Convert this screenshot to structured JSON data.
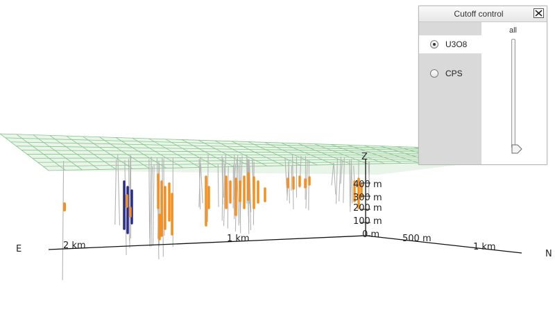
{
  "scene": {
    "axis_labels": {
      "east": "E",
      "north": "N",
      "z": "Z"
    },
    "depth_ticks": [
      "400 m",
      "300 m",
      "200 m",
      "100 m",
      "0 m"
    ],
    "east_ticks": [
      "2 km",
      "1 km"
    ],
    "north_ticks": [
      "500 m",
      "1 km"
    ],
    "colors": {
      "grid": "#86c48a",
      "grid_fill": "#e9f5e9",
      "drillhole": "#b4b4b4",
      "assay_orange": "#f5901f",
      "assay_blue": "#2a2d8c"
    }
  },
  "cutoff_panel": {
    "title": "Cutoff control",
    "close_icon": "close-icon",
    "options": [
      {
        "label": "U3O8",
        "selected": true
      },
      {
        "label": "CPS",
        "selected": false
      }
    ],
    "slider_label": "all",
    "slider_value": 0
  }
}
